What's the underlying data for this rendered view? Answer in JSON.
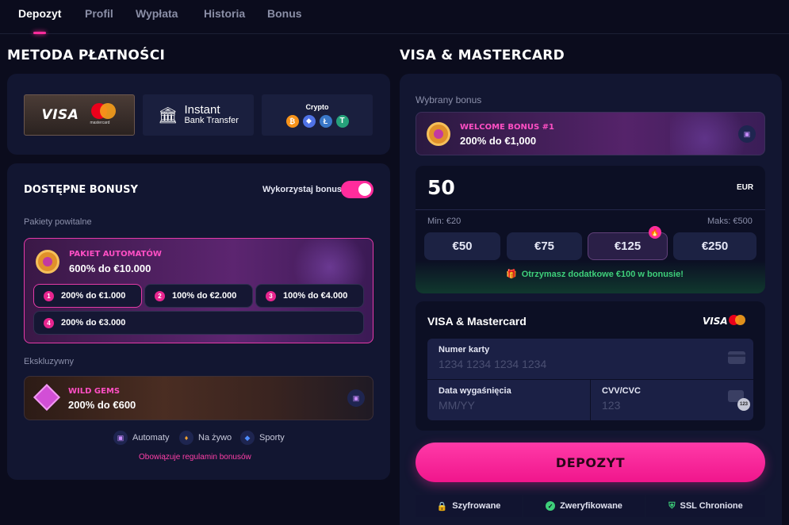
{
  "tabs": [
    {
      "label": "Depozyt"
    },
    {
      "label": "Profil"
    },
    {
      "label": "Wypłata"
    },
    {
      "label": "Historia"
    },
    {
      "label": "Bonus"
    }
  ],
  "left": {
    "title": "METODA PŁATNOŚCI",
    "methods": {
      "visa": "VISA",
      "mc_small": "mastercard",
      "instant_1": "Instant",
      "instant_2": "Bank Transfer",
      "crypto": "Crypto"
    },
    "bonuses": {
      "title": "DOSTĘPNE BONUSY",
      "toggle_label": "Wykorzystaj bonus",
      "toggle_on": true,
      "section_welcome": "Pakiety powitalne",
      "pack_name": "PAKIET AUTOMATÓW",
      "pack_value": "600% do €10.000",
      "chips": [
        {
          "n": "1",
          "label": "200% do €1.000"
        },
        {
          "n": "2",
          "label": "100% do €2.000"
        },
        {
          "n": "3",
          "label": "100% do €4.000"
        },
        {
          "n": "4",
          "label": "200% do €3.000"
        }
      ],
      "section_exclusive": "Ekskluzywny",
      "gems_name": "WILD GEMS",
      "gems_value": "200% do €600",
      "legend": [
        {
          "label": "Automaty"
        },
        {
          "label": "Na żywo"
        },
        {
          "label": "Sporty"
        }
      ],
      "terms": "Obowiązuje regulamin bonusów"
    }
  },
  "right": {
    "title": "VISA & MASTERCARD",
    "selected_bonus_label": "Wybrany bonus",
    "selected_bonus_name": "WELCOME BONUS #1",
    "selected_bonus_value": "200% do €1,000",
    "amount": "50",
    "currency": "EUR",
    "min": "Min: €20",
    "max": "Maks: €500",
    "quick_amounts": [
      "€50",
      "€75",
      "€125",
      "€250"
    ],
    "extra_bonus": "Otrzymasz dodatkowe €100 w bonusie!",
    "card_section_title": "VISA & Mastercard",
    "card_visa": "VISA",
    "card_number_label": "Numer karty",
    "card_number_placeholder": "1234 1234 1234 1234",
    "expiry_label": "Data wygaśnięcia",
    "expiry_placeholder": "MM/YY",
    "cvv_label": "CVV/CVC",
    "cvv_placeholder": "123",
    "cvv_badge": "123",
    "submit": "DEPOZYT",
    "trust": [
      "Szyfrowane",
      "Zweryfikowane",
      "SSL Chronione"
    ]
  },
  "colors": {
    "accent": "#ff2c9c",
    "bg": "#0b0c1d",
    "panel": "#121631",
    "green": "#3ecf7a"
  }
}
